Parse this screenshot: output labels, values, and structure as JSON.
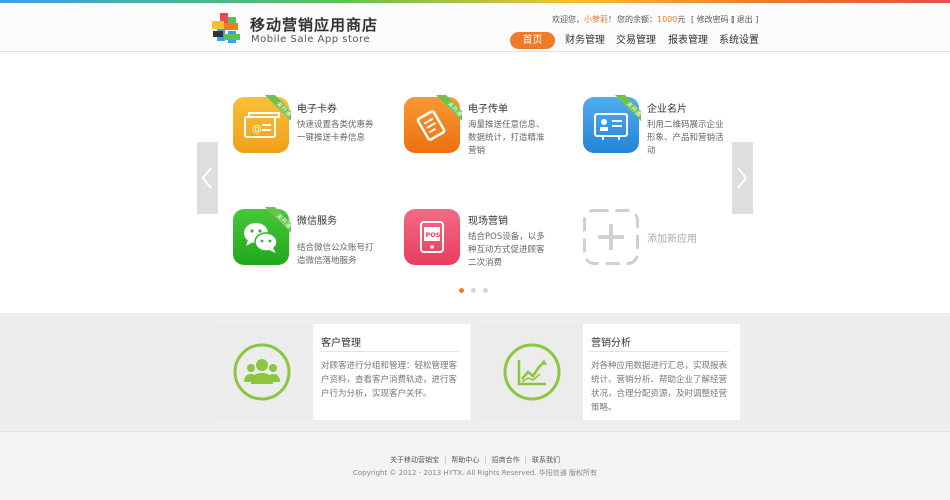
{
  "header": {
    "brand_cn": "移动营销应用商店",
    "brand_en": "Mobile Sale App store",
    "account": {
      "welcome": "欢迎您，",
      "username": "小萝莉",
      "exclaim": "！",
      "balance_label": "您的余额：",
      "balance_value": "1000",
      "balance_unit": "元",
      "change_password": "[ 修改密码 ]",
      "logout": "[ 退出 ]"
    },
    "nav": [
      {
        "label": "首页",
        "active": true
      },
      {
        "label": "财务管理"
      },
      {
        "label": "交易管理"
      },
      {
        "label": "报表管理"
      },
      {
        "label": "系统设置"
      }
    ]
  },
  "apps": [
    {
      "title": "电子卡券",
      "desc": "快速设置各类优惠券一键推送卡券信息",
      "badge": "未开通",
      "icon": "coupon-icon",
      "color": "#f2a21b"
    },
    {
      "title": "电子传单",
      "desc": "海量推送任意信息、数据统计，打造精准营销",
      "badge": "未开通",
      "icon": "flyer-icon",
      "color": "#f07a1c"
    },
    {
      "title": "企业名片",
      "desc": "利用二维码展示企业形象、产品和营销活动",
      "badge": "未开通",
      "icon": "business-card-icon",
      "color": "#2e8fe0"
    },
    {
      "title": "微信服务",
      "desc": "结合微信公众账号打造微信落地服务",
      "badge": "未开通",
      "icon": "wechat-icon",
      "color": "#35b82d"
    },
    {
      "title": "现场营销",
      "desc": "结合POS设备，以多种互动方式促进顾客二次消费",
      "badge": "",
      "icon": "pos-icon",
      "color": "#ef4d6a"
    },
    {
      "title": "添加新应用",
      "desc": "",
      "badge": "",
      "icon": "add-icon",
      "color": "#cccccc"
    }
  ],
  "carousel": {
    "pages": 3,
    "current": 1
  },
  "panels": [
    {
      "title": "客户管理",
      "desc": "对顾客进行分组和管理：轻松管理客户资料，查看客户消费轨迹，进行客户行为分析，实现客户关怀。",
      "icon": "customers-icon"
    },
    {
      "title": "营销分析",
      "desc": "对各种应用数据进行汇总，实现报表统计、营销分析、帮助企业了解经营状况，合理分配资源，及时调整经营策略。",
      "icon": "analytics-chart-icon"
    }
  ],
  "footer": {
    "links": [
      "关于移动营销宝",
      "帮助中心",
      "招商合作",
      "联系我们"
    ],
    "copyright": "Copyright © 2012 - 2013 HYTX. All Rights Reserved. 华阳信通 版权所有"
  },
  "colors": {
    "accent": "#ef7a2a",
    "green": "#8cc63f"
  }
}
